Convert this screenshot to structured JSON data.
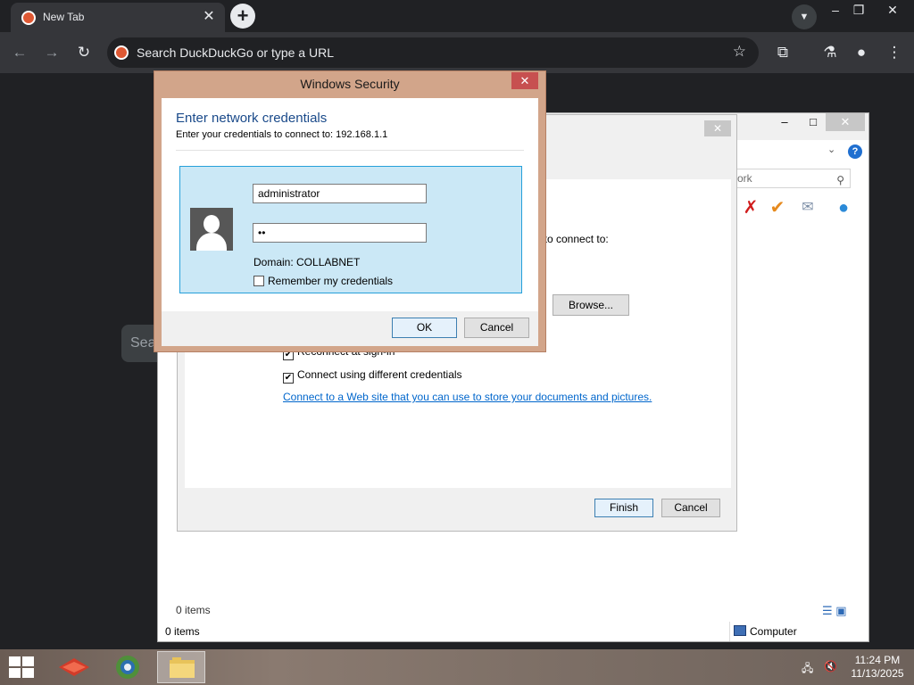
{
  "browser": {
    "tab_title": "New Tab",
    "omnibox_placeholder": "Search DuckDuckGo or type a URL",
    "page_search_fragment": "Sea"
  },
  "explorer": {
    "search_fragment": "ork",
    "status_items": "0 items",
    "status_items_bottom": "0 items",
    "status_computer": "Computer"
  },
  "wizard": {
    "text_fragment": "t to connect to:",
    "browse_label": "Browse...",
    "reconnect_label": "Reconnect at sign-in",
    "reconnect_checked": "✔",
    "different_credentials_label": "Connect using different credentials",
    "different_credentials_checked": "✔",
    "web_link": "Connect to a Web site that you can use to store your documents and pictures.",
    "finish_label": "Finish",
    "cancel_label": "Cancel"
  },
  "security_dialog": {
    "title": "Windows Security",
    "heading": "Enter network credentials",
    "subheading": "Enter your credentials to connect to: 192.168.1.1",
    "username_value": "administrator",
    "password_value": "••",
    "domain": "Domain: COLLABNET",
    "remember_label": "Remember my credentials",
    "ok_label": "OK",
    "cancel_label": "Cancel",
    "close_glyph": "✕"
  },
  "taskbar": {
    "time": "11:24 PM",
    "date": "11/13/2025"
  },
  "colors": {
    "dialog_frame": "#d2a58a",
    "credential_tile": "#cbe8f6",
    "close_button": "#c75050",
    "heading_blue": "#1a4a8a",
    "link_blue": "#0066cc"
  },
  "icons": [
    "duckduckgo-icon",
    "close-icon",
    "plus-icon",
    "chevron-down-icon",
    "back-arrow-icon",
    "forward-arrow-icon",
    "reload-icon",
    "star-icon",
    "extensions-icon",
    "labs-flask-icon",
    "profile-icon",
    "menu-icon",
    "user-avatar-icon",
    "windows-start-icon",
    "folder-icon",
    "network-icon",
    "mute-icon"
  ]
}
